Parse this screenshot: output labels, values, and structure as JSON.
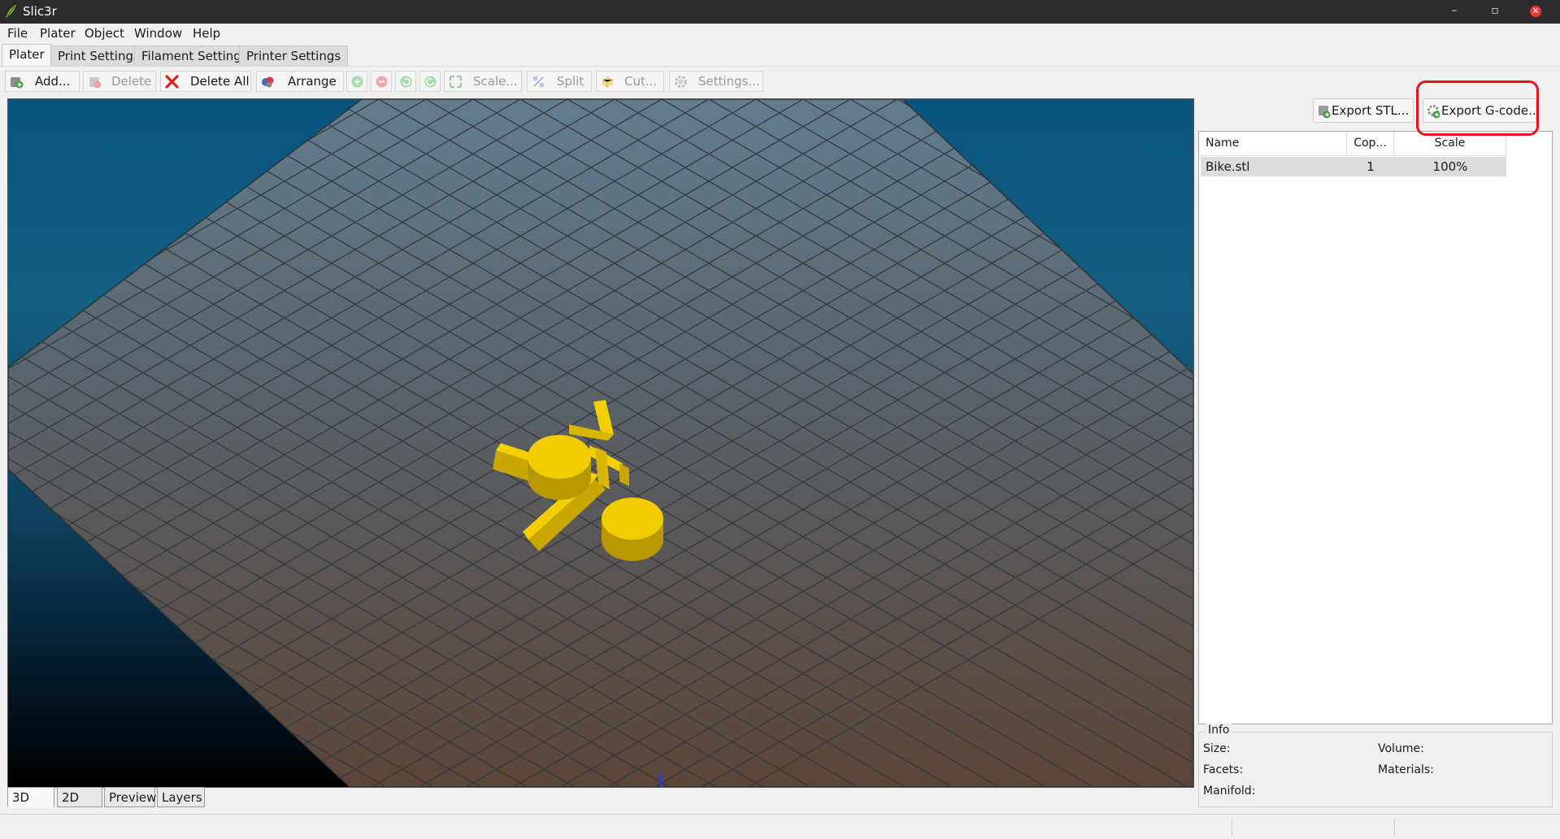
{
  "window": {
    "title": "Slic3r",
    "minimize": "–",
    "maximize": "▫",
    "close": "✕"
  },
  "menu": [
    "File",
    "Plater",
    "Object",
    "Window",
    "Help"
  ],
  "tabs": [
    "Plater",
    "Print Settings",
    "Filament Settings",
    "Printer Settings"
  ],
  "toolbar": {
    "add": "Add...",
    "delete": "Delete",
    "delete_all": "Delete All",
    "arrange": "Arrange",
    "scale": "Scale...",
    "split": "Split",
    "cut": "Cut...",
    "settings": "Settings..."
  },
  "view_tabs": [
    "3D",
    "2D",
    "Preview",
    "Layers"
  ],
  "export": {
    "stl": "Export STL...",
    "gcode": "Export G-code..."
  },
  "object_list": {
    "columns": [
      "Name",
      "Cop...",
      "Scale"
    ],
    "rows": [
      {
        "name": "Bike.stl",
        "copies": "1",
        "scale": "100%"
      }
    ]
  },
  "info": {
    "title": "Info",
    "size": "Size:",
    "volume": "Volume:",
    "facets": "Facets:",
    "materials": "Materials:",
    "manifold": "Manifold:"
  },
  "colors": {
    "accent_highlight": "#e3141e",
    "model": "#e8c400",
    "bed_grid": "#353a3d"
  },
  "icons": [
    "app-logo-icon",
    "add-icon",
    "delete-icon",
    "delete-all-icon",
    "arrange-icon",
    "increase-copies-icon",
    "decrease-copies-icon",
    "rotate-ccw-icon",
    "rotate-cw-icon",
    "scale-icon",
    "split-icon",
    "cut-icon",
    "settings-icon",
    "export-stl-icon",
    "export-gcode-icon"
  ]
}
